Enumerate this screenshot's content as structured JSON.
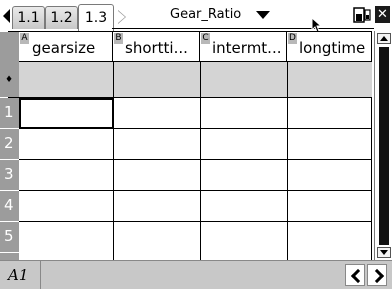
{
  "tabs": [
    {
      "label": "1.1",
      "active": false
    },
    {
      "label": "1.2",
      "active": false
    },
    {
      "label": "1.3",
      "active": true
    }
  ],
  "document": {
    "title": "Gear_Ratio"
  },
  "columns": [
    {
      "letter": "A",
      "name": "gearsize"
    },
    {
      "letter": "B",
      "name": "shortti..."
    },
    {
      "letter": "C",
      "name": "intermt..."
    },
    {
      "letter": "D",
      "name": "longtime"
    }
  ],
  "formula_row": {
    "marker": "♦"
  },
  "rows": [
    "1",
    "2",
    "3",
    "4",
    "5"
  ],
  "selected_cell": {
    "row": "1",
    "column": "A"
  },
  "status": {
    "cell_ref": "A1"
  },
  "icons": {
    "tab_scroll_left": "left-triangle-icon",
    "tab_scroll_right": "right-triangle-icon",
    "doc_menu": "dropdown-triangle-icon",
    "pointer": "mouse-pointer-icon",
    "battery": "battery-icon",
    "close": "close-icon",
    "nav_prev": "chevron-left-icon",
    "nav_next": "chevron-right-icon"
  },
  "colors": {
    "row_header_bg": "#9c9c9c",
    "formula_row_bg": "#d4d4d4",
    "status_bar_bg": "#c8c8c8"
  }
}
